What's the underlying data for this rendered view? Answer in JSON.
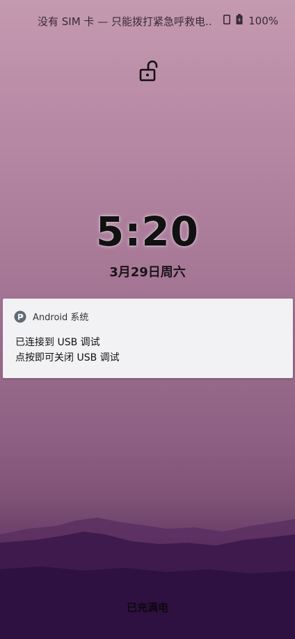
{
  "status_bar": {
    "carrier_text": "没有 SIM 卡 — 只能拨打紧急呼救电..",
    "battery_percent": "100%",
    "icons": [
      "phone-icon",
      "battery-charging-icon"
    ]
  },
  "lock": {
    "icon": "unlocked-padlock-icon"
  },
  "clock": {
    "time": "5:20",
    "date": "3月29日周六"
  },
  "notification": {
    "app_icon": "android-system-icon",
    "app_name": "Android 系统",
    "title": "已连接到 USB 调试",
    "text": "点按即可关闭 USB 调试"
  },
  "bottom": {
    "charging_status": "已充满电"
  },
  "colors": {
    "notification_bg": "#f2f1f3",
    "wallpaper_top": "#c49ab0",
    "wallpaper_bottom": "#2c1140"
  }
}
